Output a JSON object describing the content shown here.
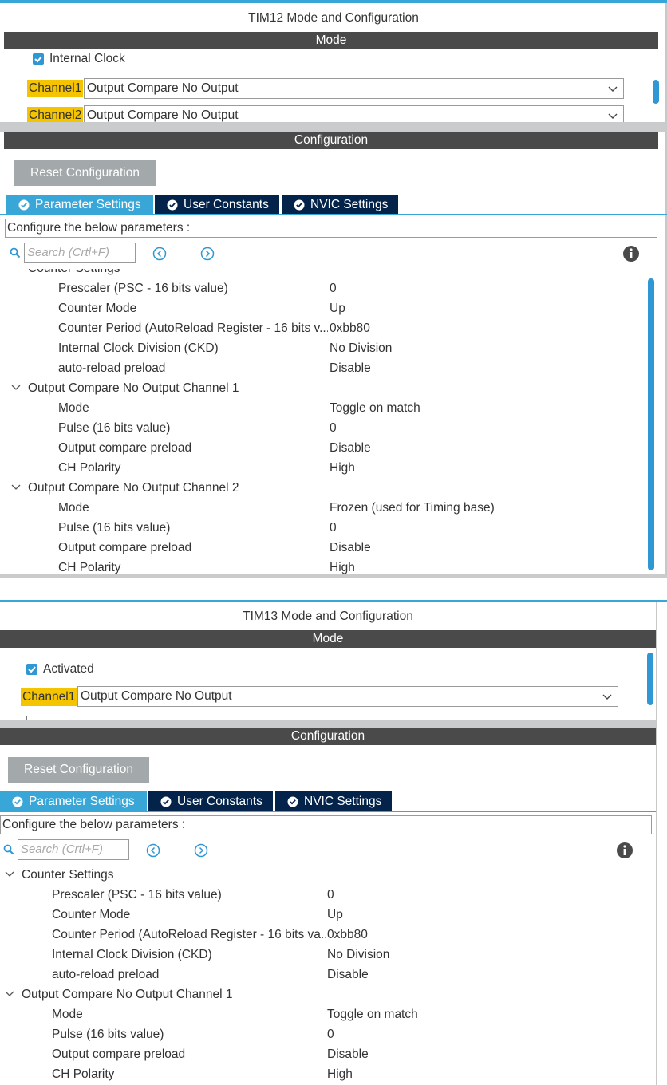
{
  "panel1": {
    "title": "TIM12 Mode and Configuration",
    "mode_header": "Mode",
    "internal_clock_label": "Internal Clock",
    "channels": [
      {
        "label": "Channel1",
        "value": "Output Compare No Output"
      },
      {
        "label": "Channel2",
        "value": "Output Compare No Output"
      }
    ],
    "config_header": "Configuration",
    "reset_button": "Reset Configuration",
    "tabs": [
      "Parameter Settings",
      "User Constants",
      "NVIC Settings"
    ],
    "configure_text": "Configure the below parameters :",
    "search_placeholder": "Search (Crtl+F)",
    "groups": [
      {
        "name": "Counter Settings",
        "params": [
          {
            "name": "Prescaler (PSC - 16 bits value)",
            "value": "0"
          },
          {
            "name": "Counter Mode",
            "value": "Up"
          },
          {
            "name": "Counter Period (AutoReload Register - 16 bits v...",
            "value": "0xbb80"
          },
          {
            "name": "Internal Clock Division (CKD)",
            "value": "No Division"
          },
          {
            "name": "auto-reload preload",
            "value": "Disable"
          }
        ]
      },
      {
        "name": "Output Compare No Output Channel 1",
        "params": [
          {
            "name": "Mode",
            "value": "Toggle on match"
          },
          {
            "name": "Pulse (16 bits value)",
            "value": "0"
          },
          {
            "name": "Output compare preload",
            "value": "Disable"
          },
          {
            "name": "CH Polarity",
            "value": "High"
          }
        ]
      },
      {
        "name": "Output Compare No Output Channel 2",
        "params": [
          {
            "name": "Mode",
            "value": "Frozen (used for Timing base)"
          },
          {
            "name": "Pulse (16 bits value)",
            "value": "0"
          },
          {
            "name": "Output compare preload",
            "value": "Disable"
          },
          {
            "name": "CH Polarity",
            "value": "High"
          }
        ]
      }
    ]
  },
  "panel2": {
    "title": "TIM13 Mode and Configuration",
    "mode_header": "Mode",
    "activated_label": "Activated",
    "channels": [
      {
        "label": "Channel1",
        "value": "Output Compare No Output"
      }
    ],
    "config_header": "Configuration",
    "reset_button": "Reset Configuration",
    "tabs": [
      "Parameter Settings",
      "User Constants",
      "NVIC Settings"
    ],
    "configure_text": "Configure the below parameters :",
    "search_placeholder": "Search (Crtl+F)",
    "groups": [
      {
        "name": "Counter Settings",
        "params": [
          {
            "name": "Prescaler (PSC - 16 bits value)",
            "value": "0"
          },
          {
            "name": "Counter Mode",
            "value": "Up"
          },
          {
            "name": "Counter Period (AutoReload Register - 16 bits va...",
            "value": "0xbb80"
          },
          {
            "name": "Internal Clock Division (CKD)",
            "value": "No Division"
          },
          {
            "name": "auto-reload preload",
            "value": "Disable"
          }
        ]
      },
      {
        "name": "Output Compare No Output Channel 1",
        "params": [
          {
            "name": "Mode",
            "value": "Toggle on match"
          },
          {
            "name": "Pulse (16 bits value)",
            "value": "0"
          },
          {
            "name": "Output compare preload",
            "value": "Disable"
          },
          {
            "name": "CH Polarity",
            "value": "High"
          }
        ]
      }
    ]
  },
  "colors": {
    "accent": "#39a6d8",
    "tab_inactive": "#03234b",
    "header_bar": "#4a4a4a",
    "channel_highlight": "#f5c400",
    "reset_button": "#a3a8ab",
    "checkbox": "#2f97d4"
  },
  "icons": [
    "checkbox-checked-icon",
    "chevron-down-icon",
    "check-circle-icon",
    "search-icon",
    "prev-arrow-icon",
    "next-arrow-icon",
    "info-icon",
    "collapse-chevron-icon"
  ]
}
